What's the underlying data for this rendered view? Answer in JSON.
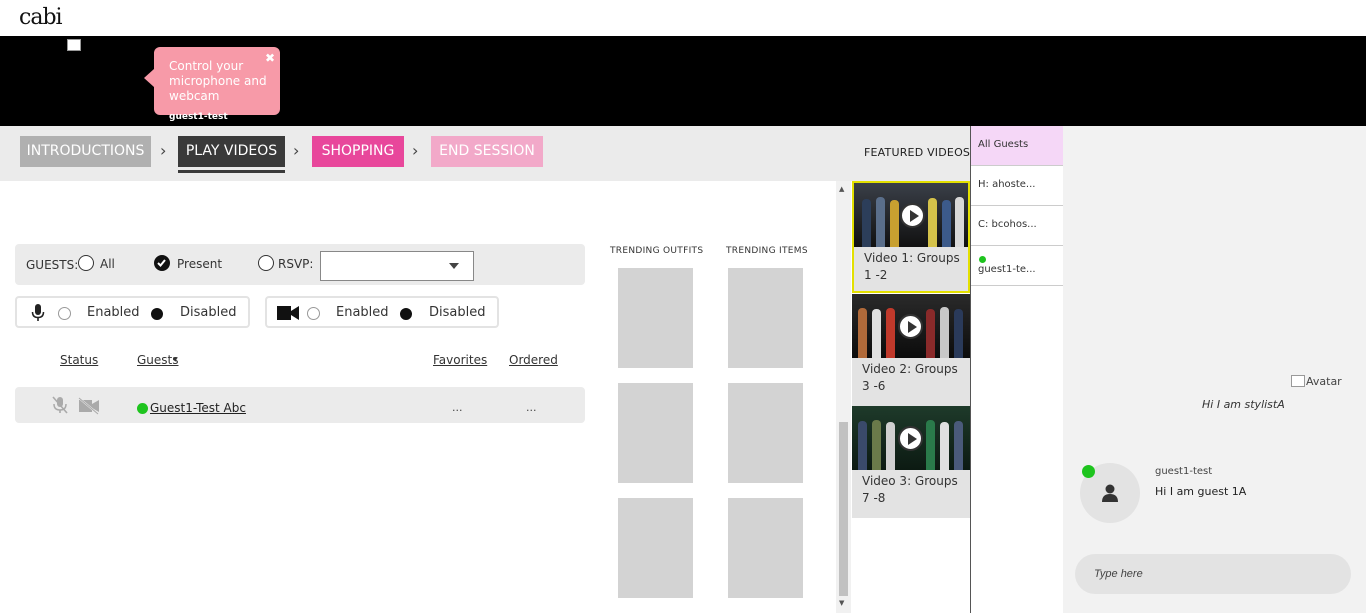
{
  "header": {
    "logo_text": "cabi"
  },
  "video_bar": {
    "tooltip_text": "Control your microphone and webcam",
    "tooltip_close": "✖",
    "self_name": "guest1-test"
  },
  "steps": [
    {
      "label": "INTRODUCTIONS",
      "state": "done",
      "color": "#b0b0b0"
    },
    {
      "label": "PLAY VIDEOS",
      "state": "active",
      "color": "#3a3a3a"
    },
    {
      "label": "SHOPPING",
      "state": "pending",
      "color": "#e8479b"
    },
    {
      "label": "END SESSION",
      "state": "disabled",
      "color": "#f2a9c9"
    }
  ],
  "featured_videos": {
    "label": "FEATURED VIDEOS",
    "videos": [
      {
        "title": "Video 1: Groups 1 -2",
        "selected": true
      },
      {
        "title": "Video 2: Groups 3 -6",
        "selected": false
      },
      {
        "title": "Video 3: Groups 7 -8",
        "selected": false
      }
    ]
  },
  "guests_filter": {
    "label": "GUESTS:",
    "options": [
      "All",
      "Present",
      "RSVP:"
    ],
    "selected": "Present",
    "rsvp_value": ""
  },
  "media_controls": {
    "mic": {
      "icon": "microphone-icon",
      "options": [
        "Enabled",
        "Disabled"
      ],
      "selected": "Disabled"
    },
    "cam": {
      "icon": "video-camera-icon",
      "options": [
        "Enabled",
        "Disabled"
      ],
      "selected": "Disabled"
    }
  },
  "table": {
    "headers": {
      "status": "Status",
      "guests": "Guests",
      "sort_indicator": "▾",
      "favorites": "Favorites",
      "ordered": "Ordered"
    },
    "rows": [
      {
        "name": "Guest1-Test Abc",
        "online": true,
        "favorites": "...",
        "ordered": "...",
        "mic_icon": "mic-muted-icon",
        "cam_icon": "camera-off-icon"
      }
    ]
  },
  "trending": {
    "outfits_label": "TRENDING OUTFITS",
    "items_label": "TRENDING ITEMS"
  },
  "guest_list": {
    "items": [
      {
        "label": "All Guests",
        "selected": true
      },
      {
        "label": "H: ahoste...",
        "selected": false
      },
      {
        "label": "C: bcohos...",
        "selected": false
      },
      {
        "label": "guest1-te...",
        "selected": false,
        "online": true
      }
    ]
  },
  "chat": {
    "messages": [
      {
        "from": "stylist",
        "avatar_alt": "Avatar",
        "text": "Hi I am stylistA"
      },
      {
        "from": "guest1-test",
        "text": "Hi I am guest 1A",
        "online": true
      }
    ],
    "input_placeholder": "Type here"
  },
  "colors": {
    "accent_pink": "#e8479b",
    "tooltip_pink": "#f79aa8",
    "online_green": "#1ec41e",
    "selected_yellow": "#e3e000",
    "guest_list_selected": "#f5d7f7"
  }
}
